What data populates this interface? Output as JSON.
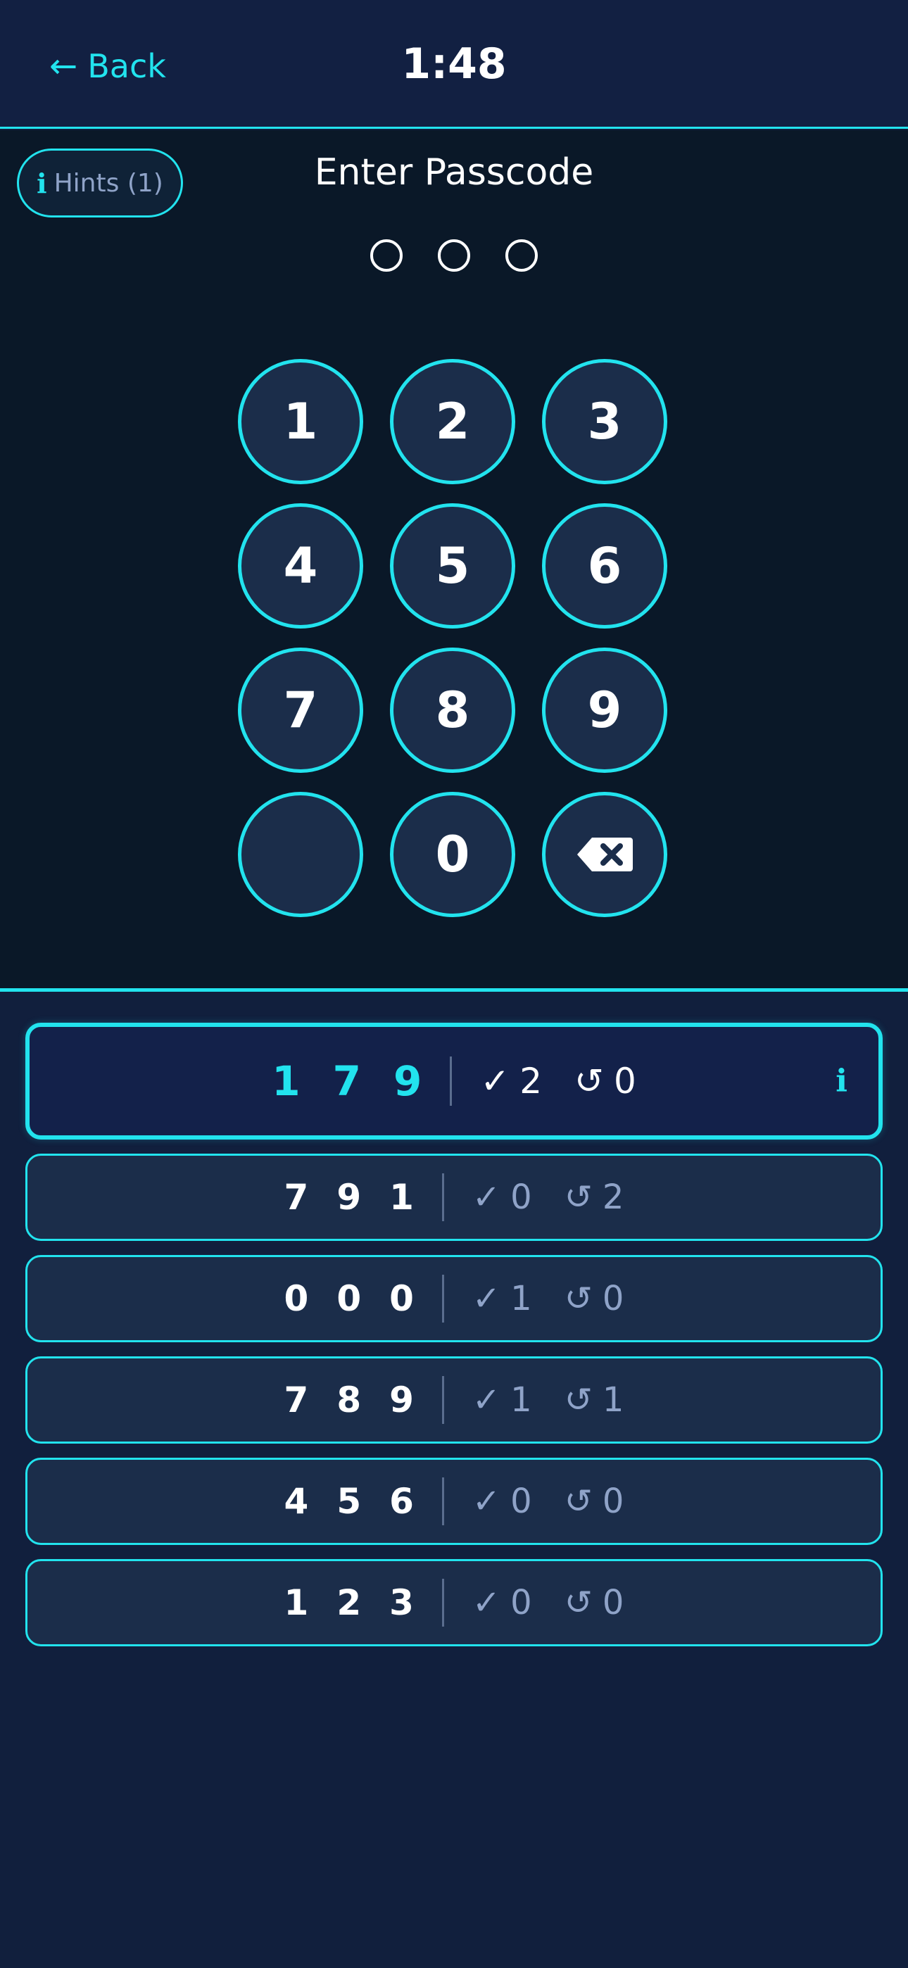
{
  "header": {
    "back_icon": "←",
    "back_label": "Back",
    "timer": "1:48"
  },
  "hints": {
    "icon": "info-icon",
    "icon_glyph": "i",
    "label": "Hints (1)"
  },
  "pad": {
    "title": "Enter Passcode",
    "entered_count": 0,
    "code_length": 3,
    "keys": [
      "1",
      "2",
      "3",
      "4",
      "5",
      "6",
      "7",
      "8",
      "9",
      "",
      "0",
      "backspace-icon"
    ]
  },
  "guesses": [
    {
      "digits": [
        "1",
        "7",
        "9"
      ],
      "correct": "2",
      "misplaced": "0",
      "active": true,
      "info_icon": "i"
    },
    {
      "digits": [
        "7",
        "9",
        "1"
      ],
      "correct": "0",
      "misplaced": "2"
    },
    {
      "digits": [
        "0",
        "0",
        "0"
      ],
      "correct": "1",
      "misplaced": "0"
    },
    {
      "digits": [
        "7",
        "8",
        "9"
      ],
      "correct": "1",
      "misplaced": "1"
    },
    {
      "digits": [
        "4",
        "5",
        "6"
      ],
      "correct": "0",
      "misplaced": "0"
    },
    {
      "digits": [
        "1",
        "2",
        "3"
      ],
      "correct": "0",
      "misplaced": "0"
    }
  ],
  "symbols": {
    "check": "✓",
    "misplaced": "↺"
  },
  "colors": {
    "accent": "#22e3ee",
    "background": "#111f3d",
    "pad_background": "#0a1828",
    "key_fill": "#1b2d4a",
    "muted_text": "#8fa3c8"
  }
}
